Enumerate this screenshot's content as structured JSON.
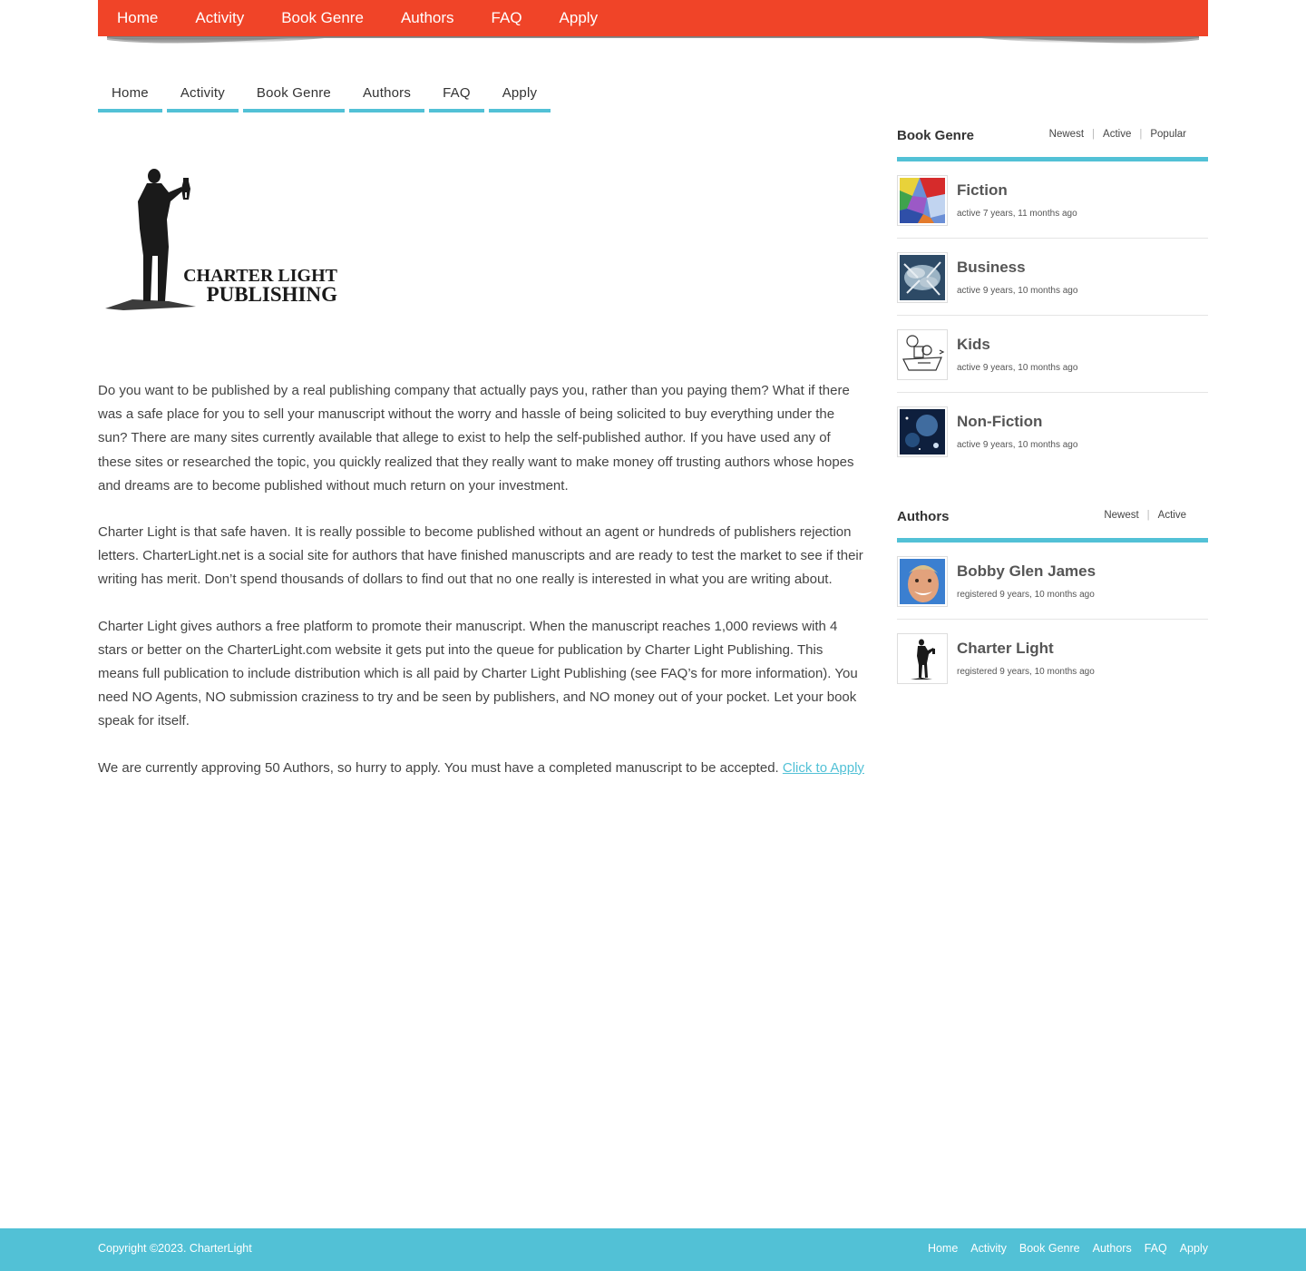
{
  "top_nav": [
    "Home",
    "Activity",
    "Book Genre",
    "Authors",
    "FAQ",
    "Apply"
  ],
  "secondary_nav": [
    "Home",
    "Activity",
    "Book Genre",
    "Authors",
    "FAQ",
    "Apply"
  ],
  "logo": {
    "line1": "CHARTER LIGHT",
    "line2": "PUBLISHING"
  },
  "content": {
    "p1": "Do you want to be published by a real publishing company that actually pays you, rather than you paying them? What if there was a safe place for you to sell your manuscript without the worry and hassle of being solicited to buy everything under the sun? There are many sites currently available that allege to exist to help the self-published author. If you have used any of these sites or researched the topic, you quickly realized that they really want to make money off trusting authors whose hopes and dreams are to become published without much return on your investment.",
    "p2": "Charter Light is that safe haven.  It is really possible to become published without an agent or hundreds of publishers rejection letters.  CharterLight.net is a social site for authors that have finished manuscripts and are ready to test the market to see if their writing has merit. Don’t spend thousands of dollars to find out that no one really is interested in what you are writing about.",
    "p3": "Charter Light gives authors a free platform to promote their manuscript. When the manuscript reaches 1,000 reviews with 4 stars or better on the CharterLight.com website it gets put into the queue for publication by Charter Light Publishing. This means full publication to include distribution which is all paid by Charter Light Publishing (see FAQ’s for more information). You need NO Agents, NO submission craziness to try and be seen by publishers, and NO money out of your pocket. Let your book speak for itself.",
    "p4": "We are currently approving 50 Authors, so hurry to apply. You must have a completed manuscript to be accepted.  ",
    "apply_link": "Click to Apply"
  },
  "book_genre_widget": {
    "title": "Book Genre",
    "filters": [
      "Newest",
      "Active",
      "Popular"
    ],
    "items": [
      {
        "name": "Fiction",
        "meta": "active 7 years, 11 months ago"
      },
      {
        "name": "Business",
        "meta": "active 9 years, 10 months ago"
      },
      {
        "name": "Kids",
        "meta": "active 9 years, 10 months ago"
      },
      {
        "name": "Non-Fiction",
        "meta": "active 9 years, 10 months ago"
      }
    ]
  },
  "authors_widget": {
    "title": "Authors",
    "filters": [
      "Newest",
      "Active"
    ],
    "items": [
      {
        "name": "Bobby Glen James",
        "meta": "registered 9 years, 10 months ago"
      },
      {
        "name": "Charter Light",
        "meta": "registered 9 years, 10 months ago"
      }
    ]
  },
  "footer": {
    "copyright": "Copyright ©2023. CharterLight",
    "links": [
      "Home",
      "Activity",
      "Book Genre",
      "Authors",
      "FAQ",
      "Apply"
    ]
  },
  "colors": {
    "top_bar": "#f04428",
    "accent": "#52c1d6"
  }
}
